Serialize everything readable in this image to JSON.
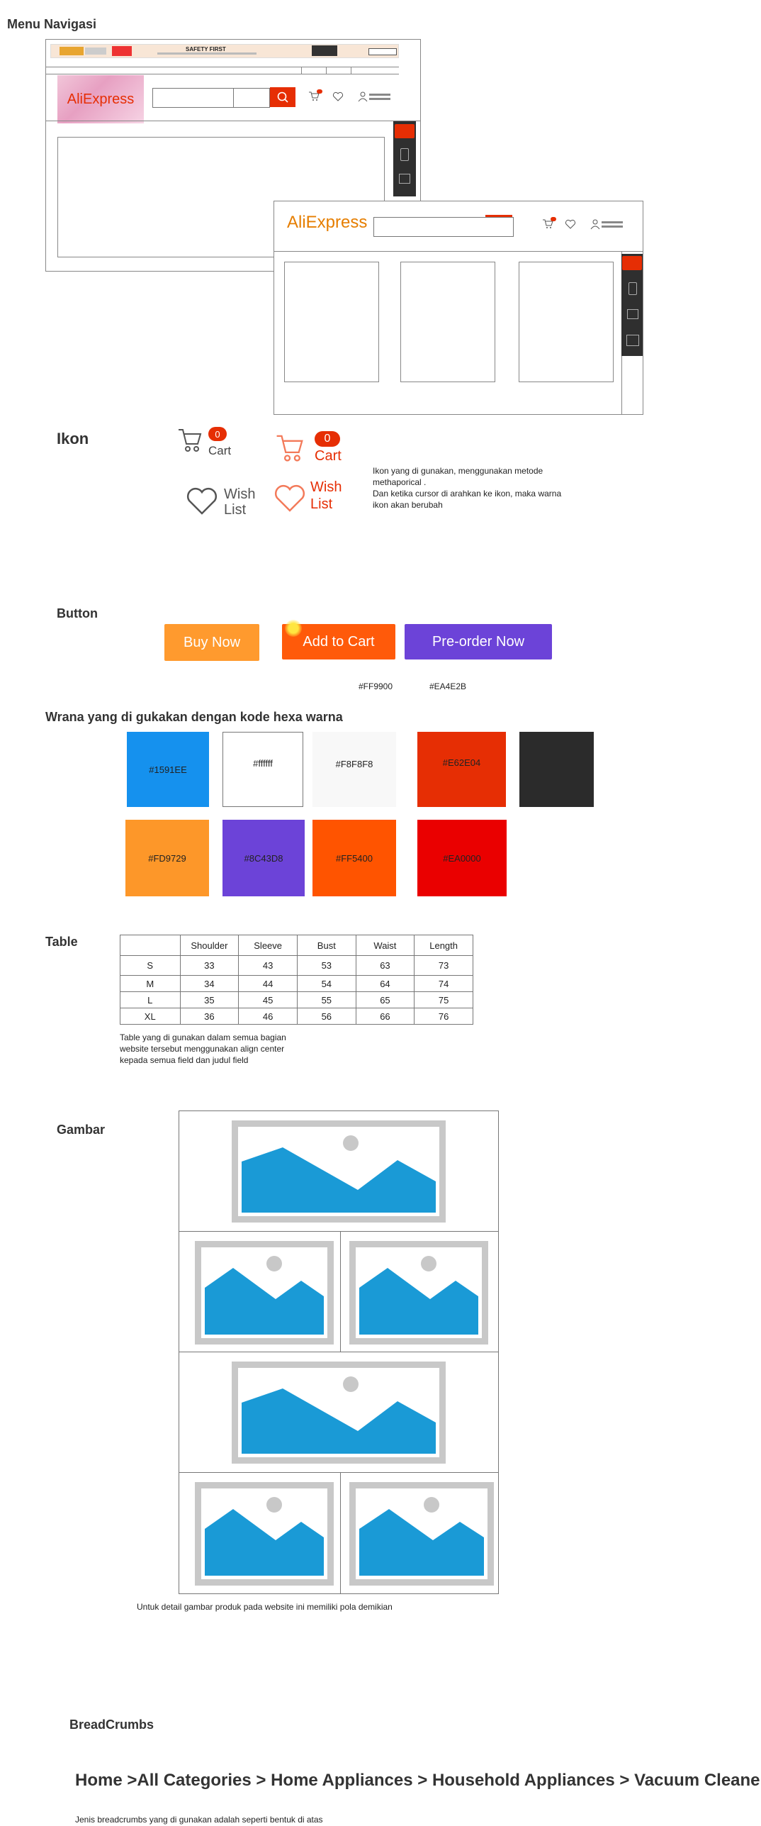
{
  "sections": {
    "menu_navigasi": "Menu Navigasi",
    "ikon": "Ikon",
    "button": "Button",
    "warna": "Wrana yang di gukakan dengan kode hexa warna",
    "table": "Table",
    "gambar": "Gambar",
    "breadcrumbs": "BreadCrumbs"
  },
  "nav_wire": {
    "banner_text": "SAFETY FIRST",
    "logo_text": "AliExpress",
    "cart_count": "0"
  },
  "icons": {
    "cart_label": "Cart",
    "cart_count": "0",
    "wish_label_line1": "Wish",
    "wish_label_line2": "List",
    "note_lines": [
      "Ikon yang di gunakan, menggunakan metode",
      "methaporical .",
      "Dan ketika cursor di arahkan ke ikon, maka warna",
      "ikon akan berubah"
    ]
  },
  "buttons": {
    "buy_now": "Buy Now",
    "add_to_cart": "Add to Cart",
    "pre_order": "Pre-order Now",
    "hex_1": "#FF9900",
    "hex_2": "#EA4E2B",
    "colors": {
      "buy_now": "#FF9A2E",
      "add_to_cart": "#FF5A0A",
      "pre_order": "#6C43D8"
    }
  },
  "swatches": [
    {
      "label": "#1591EE",
      "color": "#1591EE"
    },
    {
      "label": "#ffffff",
      "color": "#FFFFFF"
    },
    {
      "label": "#F8F8F8",
      "color": "#F8F8F8"
    },
    {
      "label": "#E62E04",
      "color": "#E62E04"
    },
    {
      "label": "",
      "color": "#2B2B2B"
    },
    {
      "label": "#FD9729",
      "color": "#FD9729"
    },
    {
      "label": "#8C43D8",
      "color": "#6C43D8"
    },
    {
      "label": "#FF5400",
      "color": "#FF5400"
    },
    {
      "label": "#EA0000",
      "color": "#EA0000"
    }
  ],
  "size_table": {
    "headers": [
      "",
      "Shoulder",
      "Sleeve",
      "Bust",
      "Waist",
      "Length"
    ],
    "rows": [
      [
        "S",
        "33",
        "43",
        "53",
        "63",
        "73"
      ],
      [
        "M",
        "34",
        "44",
        "54",
        "64",
        "74"
      ],
      [
        "L",
        "35",
        "45",
        "55",
        "65",
        "75"
      ],
      [
        "XL",
        "36",
        "46",
        "56",
        "66",
        "76"
      ]
    ],
    "note_lines": [
      "Table yang di gunakan dalam semua bagian",
      "website tersebut menggunakan align center",
      "kepada semua field dan judul field"
    ]
  },
  "gambar": {
    "note": "Untuk detail gambar produk pada website ini memiliki pola demikian"
  },
  "breadcrumbs": {
    "trail": "Home >All Categories > Home Appliances > Household Appliances > Vacuum Cleaner",
    "note": "Jenis breadcrumbs yang di gunakan adalah seperti bentuk di atas"
  }
}
